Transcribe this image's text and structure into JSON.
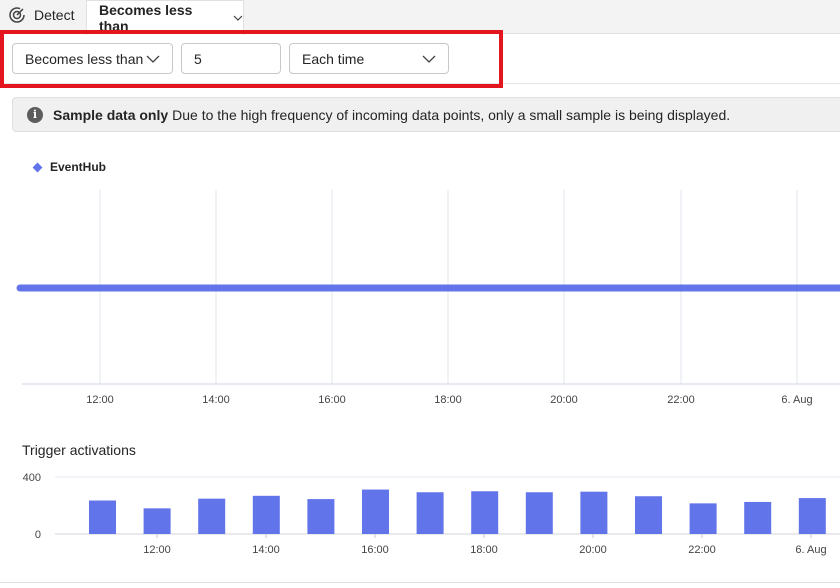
{
  "topbar": {
    "detect_label": "Detect",
    "tab_label": "Becomes less than"
  },
  "controls": {
    "condition_value": "Becomes less than",
    "threshold_value": "5",
    "frequency_value": "Each time"
  },
  "banner": {
    "title": "Sample data only",
    "message": "Due to the high frequency of incoming data points, only a small sample is being displayed."
  },
  "colors": {
    "series": "#6274ea",
    "highlight": "#e3161f"
  },
  "chart_data": [
    {
      "type": "line",
      "series": [
        {
          "name": "EventHub",
          "values": [
            1,
            1,
            1,
            1,
            1,
            1,
            1,
            1
          ]
        }
      ],
      "x_ticks": [
        "12:00",
        "14:00",
        "16:00",
        "18:00",
        "20:00",
        "22:00",
        "6. Aug"
      ],
      "grid": true
    },
    {
      "type": "bar",
      "title": "Trigger activations",
      "y_ticks": [
        "400",
        "0"
      ],
      "ylim": [
        0,
        400
      ],
      "x_ticks": [
        "12:00",
        "14:00",
        "16:00",
        "18:00",
        "20:00",
        "22:00",
        "6. Aug"
      ],
      "values": [
        235,
        180,
        248,
        268,
        245,
        312,
        293,
        300,
        293,
        297,
        265,
        215,
        225,
        252
      ]
    }
  ]
}
